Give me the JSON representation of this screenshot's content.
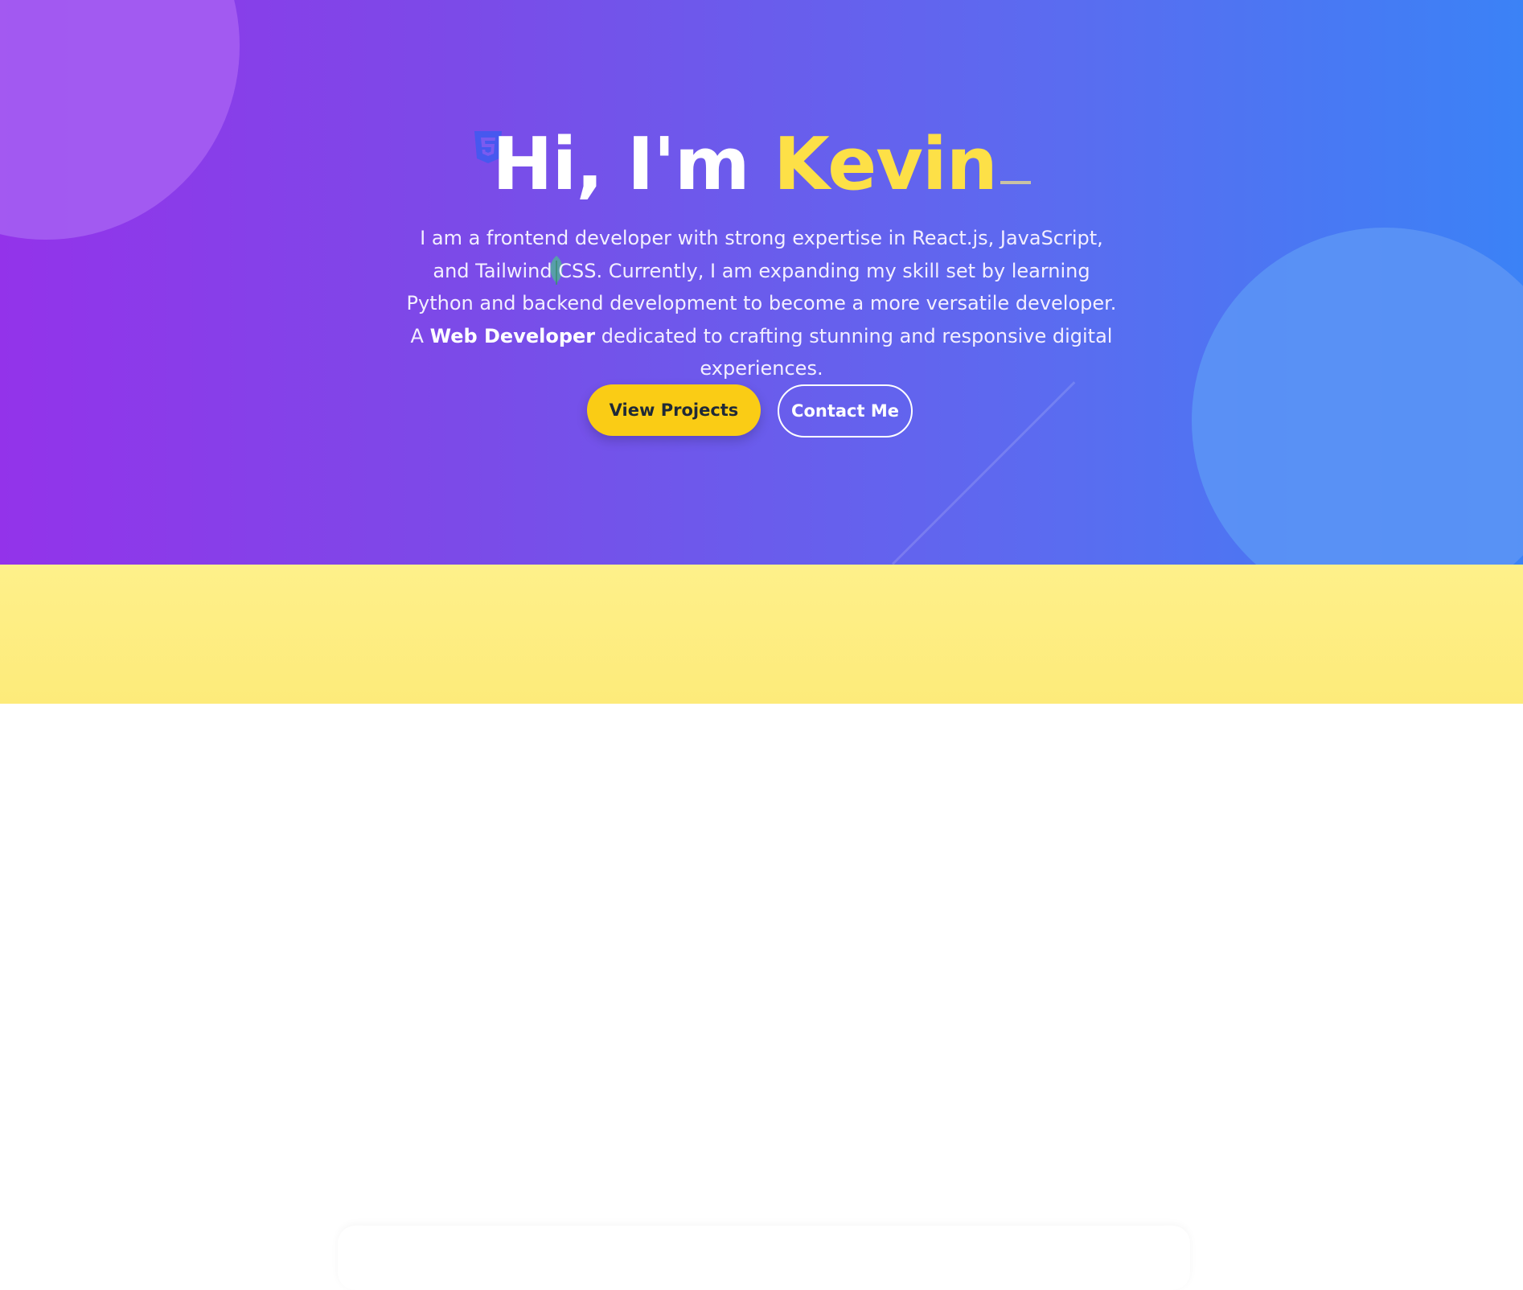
{
  "hero": {
    "greeting": "Hi, I'm ",
    "name": "Kevin",
    "intro_part1": "I am a frontend developer with strong expertise in React.js, JavaScript, and Tailwind CSS. Currently, I am expanding my skill set by learning Python and backend development to become a more versatile developer. A ",
    "intro_bold": "Web Developer",
    "intro_part2": " dedicated to crafting stunning and responsive digital experiences.",
    "primary_button": "View Projects",
    "secondary_button": "Contact Me",
    "icons": [
      "css3-icon",
      "leaf-icon"
    ]
  },
  "colors": {
    "gradient_start": "#9333ea",
    "gradient_end": "#3b82f6",
    "accent_yellow": "#facc15",
    "name_yellow": "#fde047",
    "section_yellow": "#fef08a"
  }
}
